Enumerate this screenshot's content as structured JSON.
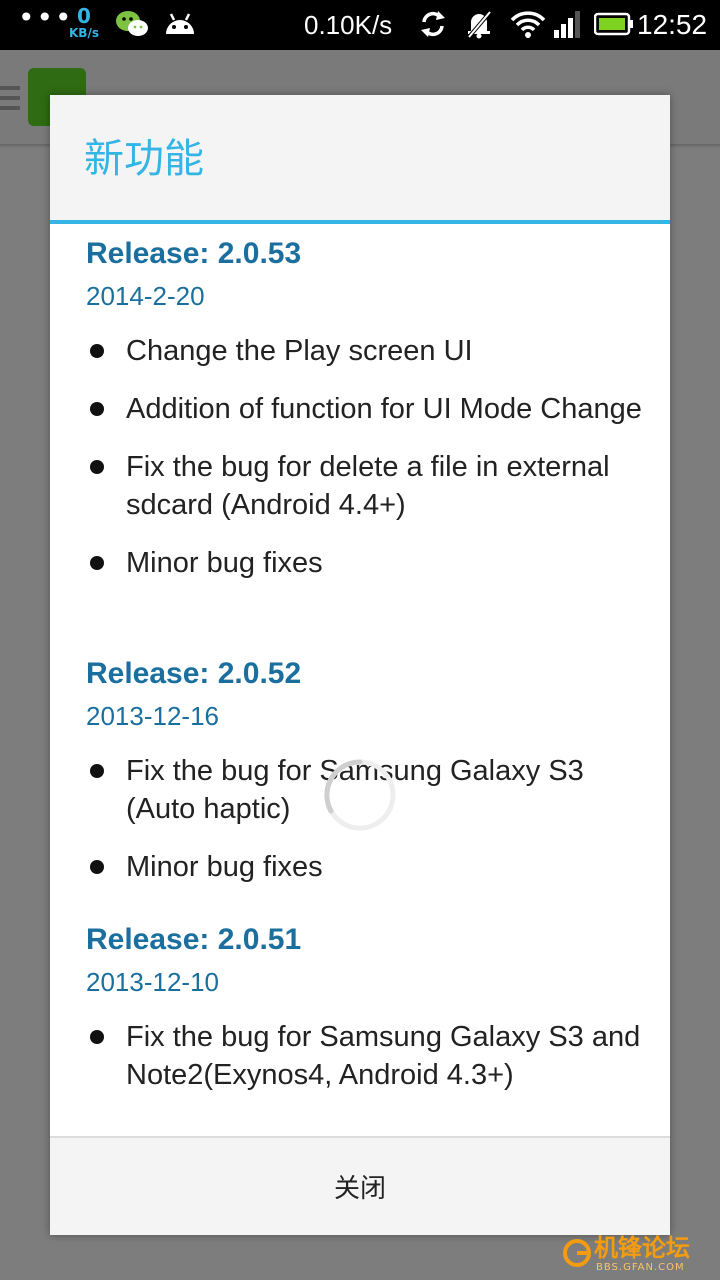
{
  "status_bar": {
    "dots": "•••",
    "net_value": "0",
    "net_unit": "KB/s",
    "speed": "0.10K/s",
    "time": "12:52"
  },
  "dialog": {
    "title": "新功能",
    "close_label": "关闭",
    "releases": [
      {
        "heading": "Release: 2.0.53",
        "date": "2014-2-20",
        "items": [
          "Change the Play screen UI",
          "Addition of function for UI Mode Change",
          "Fix the bug for delete a file in external sdcard (Android 4.4+)",
          "Minor bug fixes"
        ]
      },
      {
        "heading": "Release: 2.0.52",
        "date": "2013-12-16",
        "items": [
          "Fix the bug for Samsung Galaxy S3 (Auto haptic)",
          "Minor bug fixes"
        ]
      },
      {
        "heading": "Release: 2.0.51",
        "date": "2013-12-10",
        "items": [
          "Fix the bug for Samsung Galaxy S3 and Note2(Exynos4, Android 4.3+)"
        ]
      }
    ]
  },
  "watermark": {
    "text": "机锋论坛",
    "sub": "BBS.GFAN.COM"
  },
  "colors": {
    "accent": "#33b5e5",
    "release_heading": "#1a6f9e"
  }
}
